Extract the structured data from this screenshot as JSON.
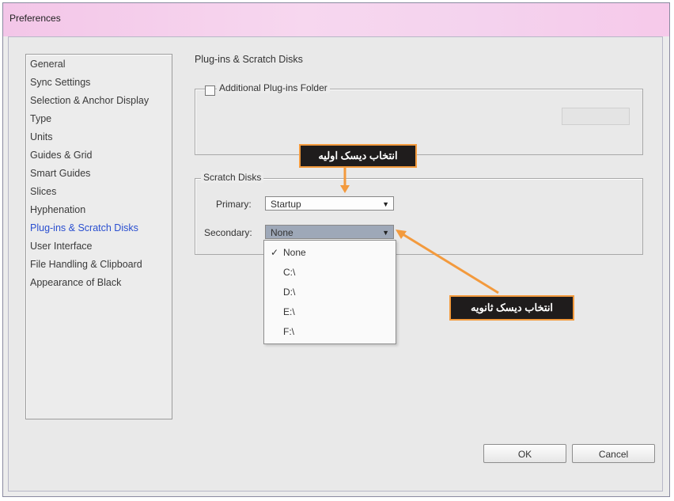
{
  "window": {
    "title": "Preferences"
  },
  "sidebar": {
    "items": [
      {
        "label": "General"
      },
      {
        "label": "Sync Settings"
      },
      {
        "label": "Selection & Anchor Display"
      },
      {
        "label": "Type"
      },
      {
        "label": "Units"
      },
      {
        "label": "Guides & Grid"
      },
      {
        "label": "Smart Guides"
      },
      {
        "label": "Slices"
      },
      {
        "label": "Hyphenation"
      },
      {
        "label": "Plug-ins & Scratch Disks"
      },
      {
        "label": "User Interface"
      },
      {
        "label": "File Handling & Clipboard"
      },
      {
        "label": "Appearance of Black"
      }
    ],
    "selected": "Plug-ins & Scratch Disks"
  },
  "main": {
    "section_title": "Plug-ins & Scratch Disks",
    "plugins_group": {
      "checkbox_label": "Additional Plug-ins Folder",
      "checked": false
    },
    "scratch_group": {
      "legend": "Scratch Disks",
      "primary_label": "Primary:",
      "primary_value": "Startup",
      "secondary_label": "Secondary:",
      "secondary_value": "None"
    },
    "dropdown_options": [
      "None",
      "C:\\",
      "D:\\",
      "E:\\",
      "F:\\"
    ],
    "dropdown_selected": "None",
    "check_mark": "✓"
  },
  "annotations": {
    "primary_callout": "انتخاب دیسک اولیه",
    "secondary_callout": "انتخاب دیسک ثانویه",
    "callout_color": "#f39a3d"
  },
  "buttons": {
    "ok": "OK",
    "cancel": "Cancel"
  }
}
